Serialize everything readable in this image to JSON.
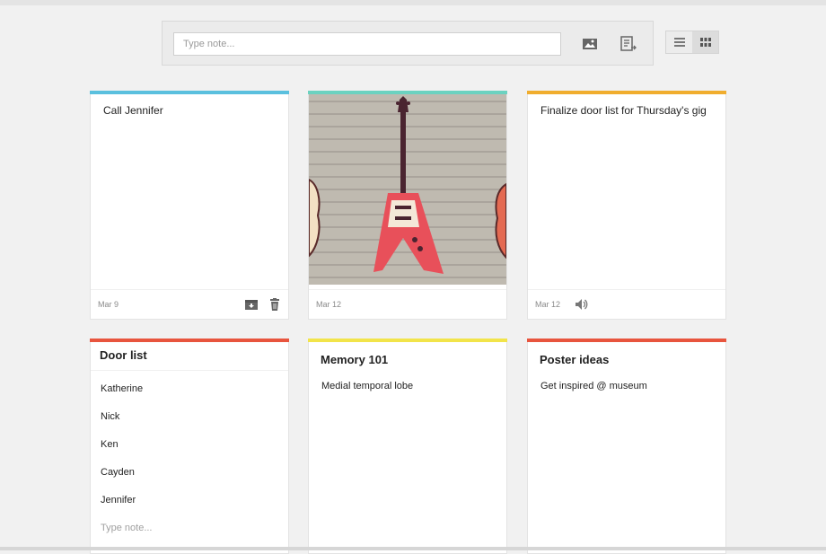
{
  "composer": {
    "placeholder": "Type note...",
    "image_icon": "image-icon",
    "list_icon": "new-list-icon"
  },
  "view_toggle": {
    "list_view_icon": "list-view-icon",
    "grid_view_icon": "grid-view-icon",
    "active": "grid"
  },
  "cards": [
    {
      "id": "call-jennifer",
      "color": "#5bc0de",
      "text": "Call Jennifer",
      "date": "Mar 9",
      "icons": [
        "archive-icon",
        "trash-icon"
      ]
    },
    {
      "id": "guitar",
      "color": "#6bd2c0",
      "image": "guitar-illustration",
      "date": "Mar 12"
    },
    {
      "id": "door-list-gig",
      "color": "#f0ad2e",
      "text": "Finalize door list for Thursday's gig",
      "date": "Mar 12",
      "icons": [
        "audio-icon"
      ]
    },
    {
      "id": "door-list",
      "color": "#e8553e",
      "title": "Door list",
      "items": [
        "Katherine",
        "Nick",
        "Ken",
        "Cayden",
        "Jennifer"
      ],
      "item_placeholder": "Type note..."
    },
    {
      "id": "memory-101",
      "color": "#f2e44a",
      "title": "Memory 101",
      "text": "Medial temporal lobe"
    },
    {
      "id": "poster-ideas",
      "color": "#e8553e",
      "title": "Poster ideas",
      "text": "Get inspired @ museum"
    }
  ]
}
